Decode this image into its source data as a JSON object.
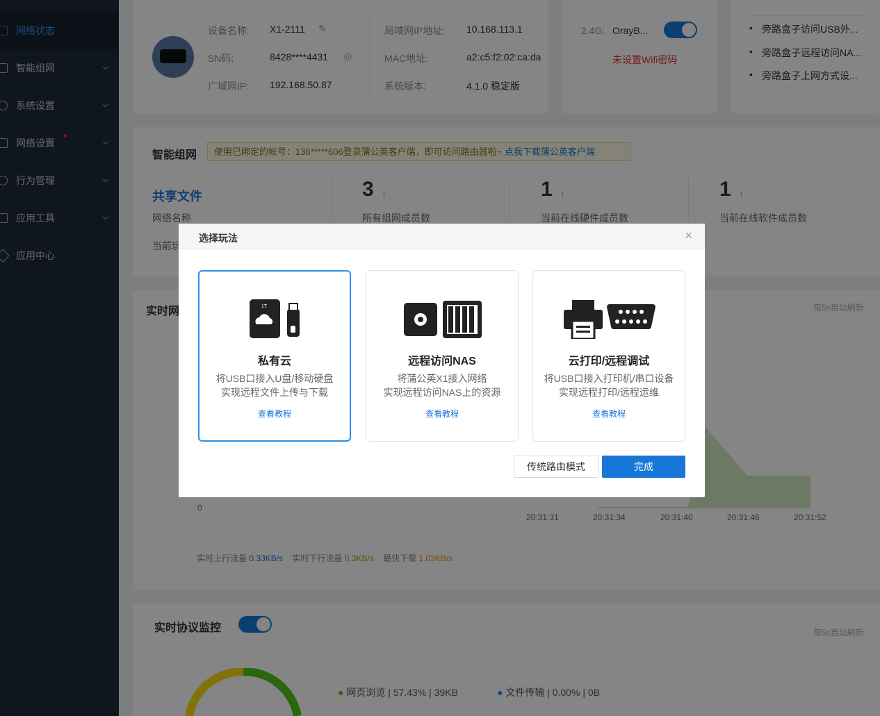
{
  "sidebar": {
    "items": [
      {
        "label": "网络状态",
        "active": true
      },
      {
        "label": "智能组网"
      },
      {
        "label": "系统设置"
      },
      {
        "label": "网络设置",
        "badge": true
      },
      {
        "label": "行为管理"
      },
      {
        "label": "应用工具"
      },
      {
        "label": "应用中心"
      }
    ]
  },
  "device": {
    "name_label": "设备名称:",
    "name_value": "X1-2111",
    "sn_label": "SN码:",
    "sn_value": "8428****4431",
    "wan_label": "广域网IP:",
    "wan_value": "192.168.50.87",
    "lan_label": "局域网IP地址:",
    "lan_value": "10.168.113.1",
    "mac_label": "MAC地址:",
    "mac_value": "a2:c5:f2:02:ca:da",
    "version_label": "系统版本:",
    "version_value": "4.1.0 稳定版"
  },
  "wifi": {
    "band": "2.4G:",
    "ssid": "OrayB...",
    "warning": "未设置Wifi密码",
    "enabled": true
  },
  "help_links": [
    "旁路盒子访问USB外...",
    "旁路盒子远程访问NA...",
    "旁路盒子上网方式设..."
  ],
  "smart_network": {
    "title": "智能组网",
    "notice_text": "使用已绑定的帐号：136*****606登录蒲公英客户端，即可访问路由器啦~ ",
    "notice_link": "点我下载蒲公英客户端",
    "share_title": "共享文件",
    "share_name_label": "网络名称",
    "share_current_label": "当前玩",
    "stats": [
      {
        "value": "3",
        "label": "所有组网成员数"
      },
      {
        "value": "1",
        "label": "当前在线硬件成员数"
      },
      {
        "value": "1",
        "label": "当前在线软件成员数"
      }
    ]
  },
  "realtime": {
    "title": "实时网",
    "refresh": "每5s自动刷新",
    "y_zero": "0",
    "times": [
      "20:31:31",
      "20:31:34",
      "20:31:40",
      "20:31:46",
      "20:31:52"
    ],
    "up_label": "实时上行流量",
    "up_value": "0.33KB/s",
    "down_label": "实时下行流量",
    "down_value": "0.3KB/s",
    "max_label": "最快下载",
    "max_value": "1.03KB/s",
    "up_color": "#1677d8",
    "down_color": "#7cb305",
    "max_color": "#fa8c16"
  },
  "protocol": {
    "title": "实时协议监控",
    "refresh": "每5s自动刷新",
    "enabled": true,
    "legend": [
      {
        "name": "网页浏览",
        "percent": "57.43%",
        "size": "39KB",
        "color": "#52c41a"
      },
      {
        "name": "文件传输",
        "percent": "0.00%",
        "size": "0B",
        "color": "#1890ff"
      }
    ]
  },
  "modal": {
    "title": "选择玩法",
    "close": "×",
    "options": [
      {
        "title": "私有云",
        "desc1": "将USB口接入U盘/移动硬盘",
        "desc2": "实现远程文件上传与下载",
        "link": "查看教程",
        "selected": true
      },
      {
        "title": "远程访问NAS",
        "desc1": "将蒲公英X1接入网络",
        "desc2": "实现远程访问NAS上的资源",
        "link": "查看教程"
      },
      {
        "title": "云打印/远程调试",
        "desc1": "将USB口接入打印机/串口设备",
        "desc2": "实现远程打印/远程运维",
        "link": "查看教程"
      }
    ],
    "btn_secondary": "传统路由模式",
    "btn_primary": "完成"
  }
}
